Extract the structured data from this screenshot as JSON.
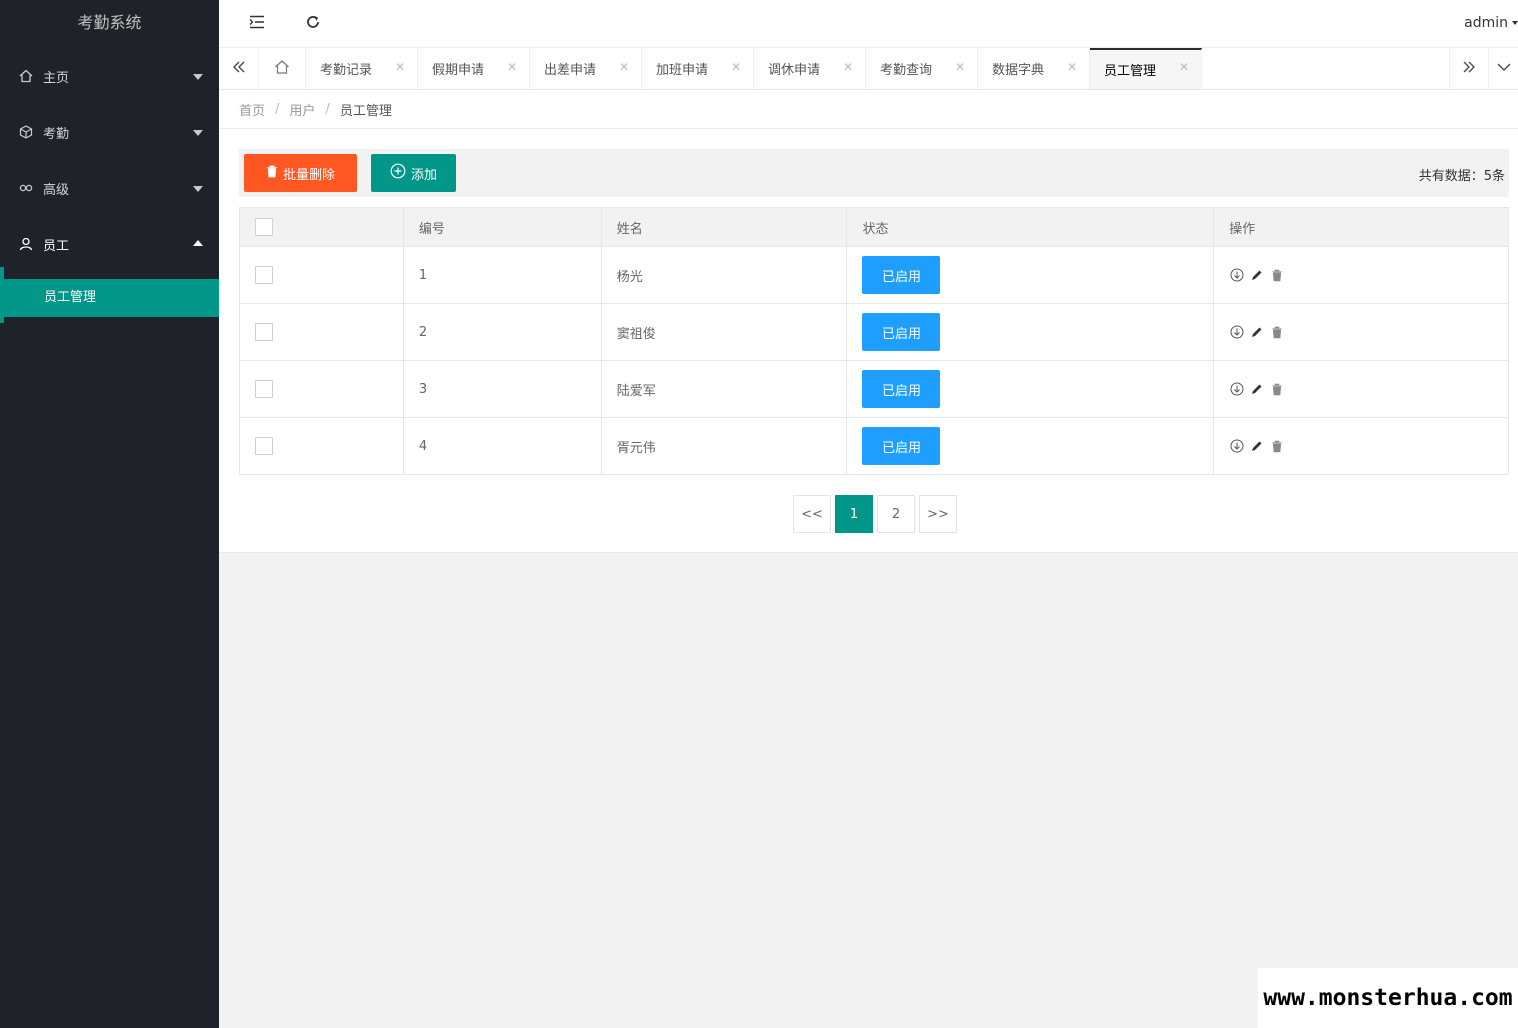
{
  "app": {
    "title": "考勤系统"
  },
  "sidebar": {
    "items": [
      {
        "label": "主页",
        "icon": "home-icon",
        "state": "collapsed"
      },
      {
        "label": "考勤",
        "icon": "cube-icon",
        "state": "collapsed"
      },
      {
        "label": "高级",
        "icon": "link-icon",
        "state": "collapsed"
      },
      {
        "label": "员工",
        "icon": "user-icon",
        "state": "expanded"
      }
    ],
    "sub_items": [
      {
        "label": "员工管理",
        "active": true
      }
    ]
  },
  "header": {
    "flexible_icon": "menu-collapse-icon",
    "refresh_icon": "refresh-icon",
    "user": "admin"
  },
  "tabs": {
    "items": [
      {
        "label": "考勤记录"
      },
      {
        "label": "假期申请"
      },
      {
        "label": "出差申请"
      },
      {
        "label": "加班申请"
      },
      {
        "label": "调休申请"
      },
      {
        "label": "考勤查询"
      },
      {
        "label": "数据字典"
      },
      {
        "label": "员工管理",
        "active": true
      }
    ],
    "close_glyph": "✕"
  },
  "breadcrumb": {
    "items": [
      "首页",
      "用户",
      "员工管理"
    ],
    "separator": "/"
  },
  "toolbar": {
    "batch_delete_label": "批量删除",
    "add_label": "添加",
    "total_text": "共有数据：5条"
  },
  "table": {
    "headers": [
      "编号",
      "姓名",
      "状态",
      "操作"
    ],
    "rows": [
      {
        "id": "1",
        "name": "杨光",
        "status": "已启用"
      },
      {
        "id": "2",
        "name": "窦祖俊",
        "status": "已启用"
      },
      {
        "id": "3",
        "name": "陆爱军",
        "status": "已启用"
      },
      {
        "id": "4",
        "name": "胥元伟",
        "status": "已启用"
      }
    ]
  },
  "pagination": {
    "prev": "<<",
    "pages": [
      "1",
      "2"
    ],
    "current": "1",
    "next": ">>"
  },
  "watermark": "www.monsterhua.com",
  "colors": {
    "sidebar": "#20222a",
    "accent": "#009688",
    "danger": "#ff5722",
    "info": "#1e9fff"
  }
}
